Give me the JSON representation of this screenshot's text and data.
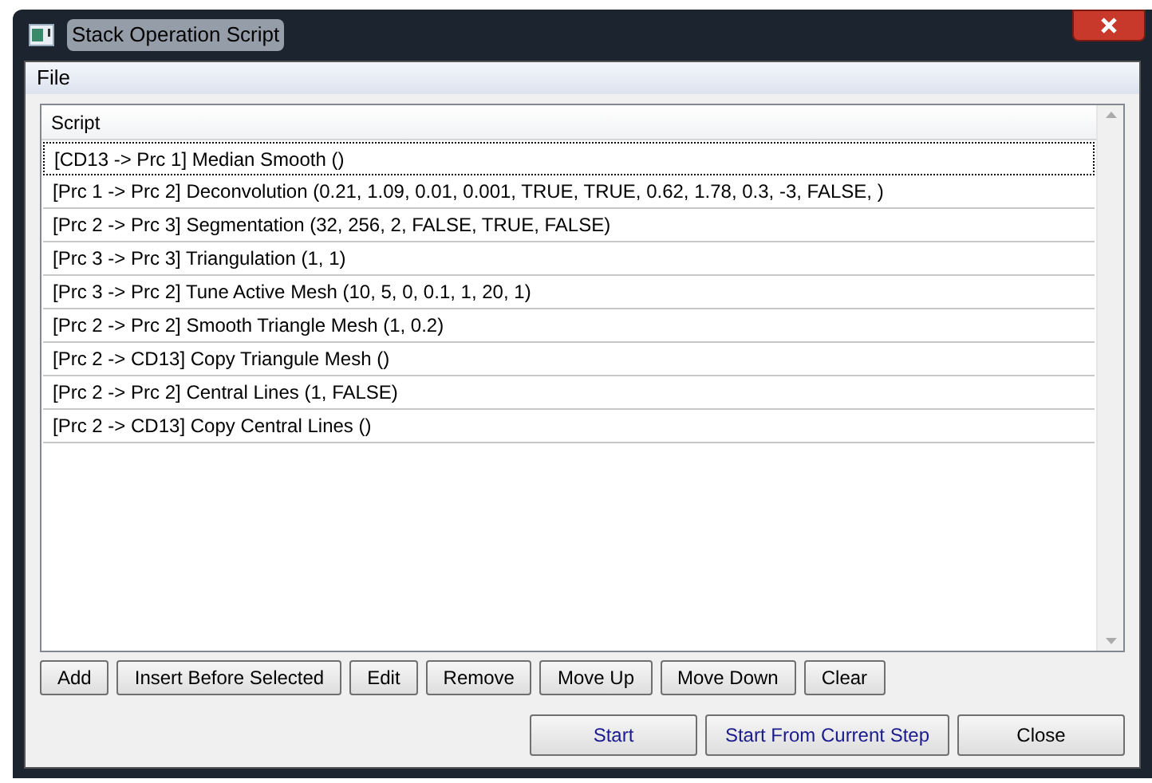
{
  "window": {
    "title": "Stack Operation Script"
  },
  "menu": [
    "File"
  ],
  "table": {
    "columns": [
      "Script"
    ],
    "rows": [
      {
        "text": "[CD13 -> Prc 1] Median Smooth ()",
        "selected": true
      },
      {
        "text": "[Prc 1 -> Prc 2] Deconvolution (0.21, 1.09, 0.01, 0.001, TRUE, TRUE, 0.62, 1.78, 0.3, -3, FALSE, )",
        "selected": false
      },
      {
        "text": "[Prc 2 -> Prc 3] Segmentation (32, 256, 2, FALSE, TRUE, FALSE)",
        "selected": false
      },
      {
        "text": "[Prc 3 -> Prc 3] Triangulation (1, 1)",
        "selected": false
      },
      {
        "text": "[Prc 3 -> Prc 2] Tune Active Mesh (10, 5, 0, 0.1, 1, 20, 1)",
        "selected": false
      },
      {
        "text": "[Prc 2 -> Prc 2] Smooth Triangle Mesh (1, 0.2)",
        "selected": false
      },
      {
        "text": "[Prc 2 -> CD13] Copy Triangule Mesh ()",
        "selected": false
      },
      {
        "text": "[Prc 2 -> Prc 2] Central Lines (1, FALSE)",
        "selected": false
      },
      {
        "text": "[Prc 2 -> CD13] Copy Central Lines ()",
        "selected": false
      }
    ]
  },
  "edit_buttons": [
    "Add",
    "Insert Before Selected",
    "Edit",
    "Remove",
    "Move Up",
    "Move Down",
    "Clear"
  ],
  "run_buttons": [
    "Start",
    "Start From Current Step",
    "Close"
  ]
}
